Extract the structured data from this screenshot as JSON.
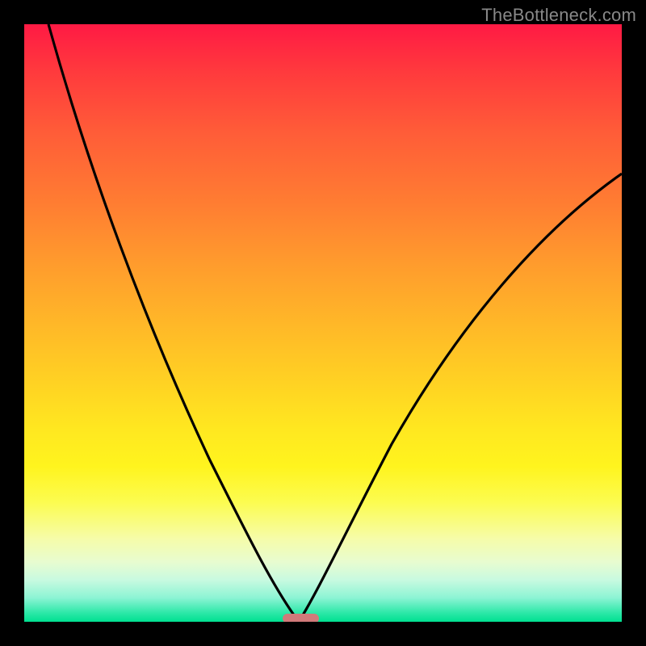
{
  "watermark": "TheBottleneck.com",
  "chart_data": {
    "type": "line",
    "title": "",
    "xlabel": "",
    "ylabel": "",
    "xlim": [
      0,
      100
    ],
    "ylim": [
      0,
      100
    ],
    "grid": false,
    "legend": false,
    "gradient_bands": [
      {
        "name": "red",
        "color": "#ff1a44",
        "y_percent_from_top": 0
      },
      {
        "name": "orange",
        "color": "#ff9b2d",
        "y_percent_from_top": 40
      },
      {
        "name": "yellow",
        "color": "#ffe820",
        "y_percent_from_top": 70
      },
      {
        "name": "pale",
        "color": "#f6fca8",
        "y_percent_from_top": 86
      },
      {
        "name": "green",
        "color": "#00e090",
        "y_percent_from_top": 100
      }
    ],
    "optimal_marker": {
      "x": 46,
      "color": "#d17a7a"
    },
    "series": [
      {
        "name": "left_curve",
        "x": [
          4,
          7,
          10,
          14,
          18,
          22,
          26,
          30,
          34,
          37,
          40,
          42.5,
          44.5,
          46
        ],
        "values": [
          100,
          92,
          84,
          75,
          66,
          57,
          48,
          39,
          30,
          23,
          15,
          9,
          4,
          0
        ]
      },
      {
        "name": "right_curve",
        "x": [
          46,
          48.5,
          51,
          54,
          58,
          62,
          67,
          72,
          78,
          85,
          92,
          100
        ],
        "values": [
          0,
          5,
          10,
          16,
          23,
          30,
          38,
          45,
          53,
          61,
          68,
          75
        ]
      }
    ]
  }
}
